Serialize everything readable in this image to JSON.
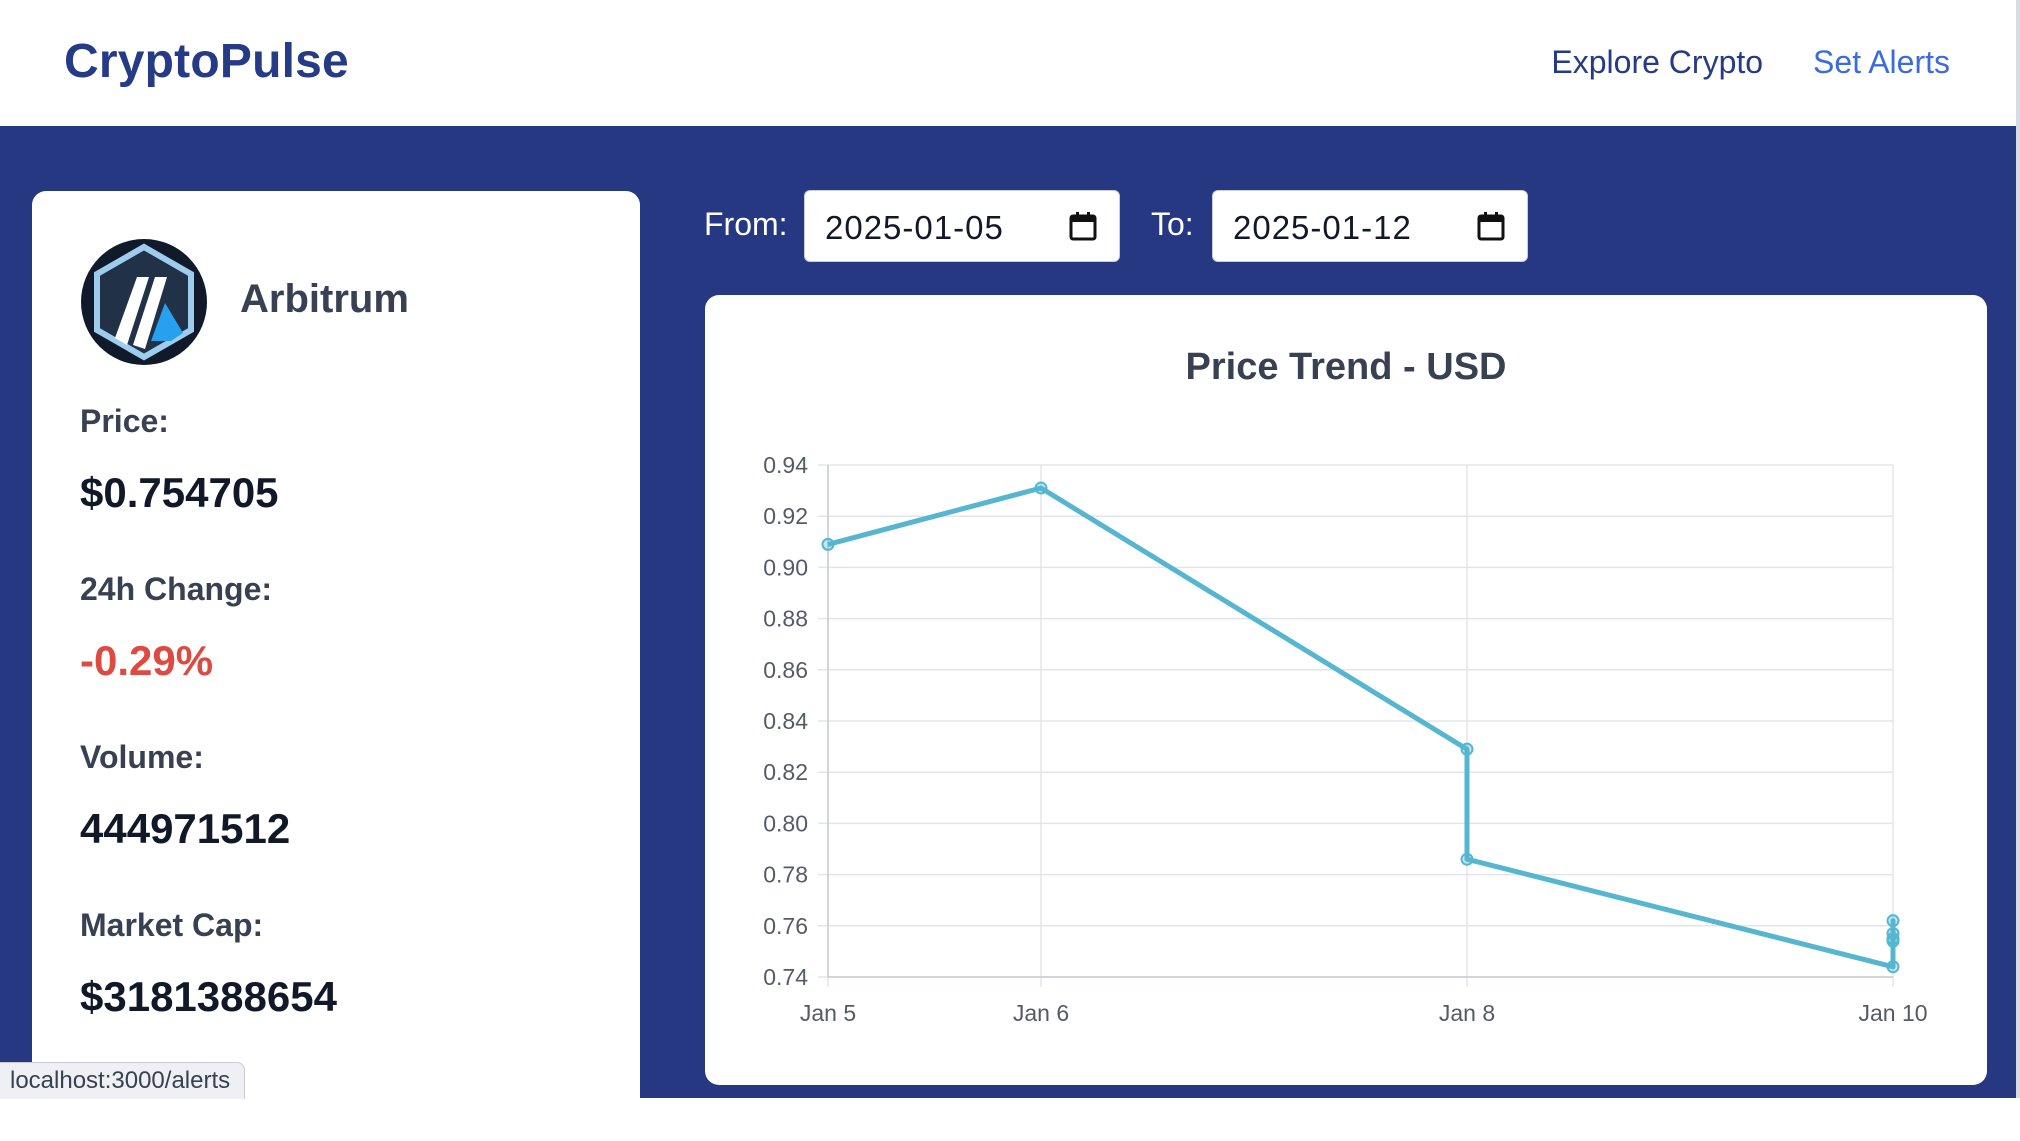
{
  "header": {
    "brand": "CryptoPulse",
    "nav": {
      "explore": "Explore Crypto",
      "alerts": "Set Alerts"
    }
  },
  "coin": {
    "name": "Arbitrum",
    "stats": [
      {
        "label": "Price:",
        "value": "$0.754705",
        "color": "#111827"
      },
      {
        "label": "24h Change:",
        "value": "-0.29%",
        "color": "#dc4a42"
      },
      {
        "label": "Volume:",
        "value": "444971512",
        "color": "#111827"
      },
      {
        "label": "Market Cap:",
        "value": "$3181388654",
        "color": "#111827"
      }
    ]
  },
  "date_range": {
    "from_label": "From:",
    "from_value": "2025-01-05",
    "to_label": "To:",
    "to_value": "2025-01-12"
  },
  "status_bar": {
    "url": "localhost:3000/alerts"
  },
  "colors": {
    "brand": "#253b86",
    "link": "#3c6be0",
    "background": "#263882",
    "line": "#56b6d0",
    "negative": "#dc4a42"
  },
  "chart_data": {
    "type": "line",
    "title": "Price Trend - USD",
    "x_ticks": [
      "Jan 5",
      "Jan 6",
      "Jan 8",
      "Jan 10"
    ],
    "y_ticks": [
      "0.94",
      "0.92",
      "0.90",
      "0.88",
      "0.86",
      "0.84",
      "0.82",
      "0.80",
      "0.78",
      "0.76",
      "0.74"
    ],
    "ylim": [
      0.74,
      0.94
    ],
    "xlim": [
      "2025-01-05",
      "2025-01-10"
    ],
    "grid": true,
    "series": [
      {
        "points": [
          {
            "x": "2025-01-05",
            "y": 0.909
          },
          {
            "x": "2025-01-06",
            "y": 0.931
          },
          {
            "x": "2025-01-08",
            "y": 0.829
          },
          {
            "x": "2025-01-08",
            "y": 0.786
          },
          {
            "x": "2025-01-10",
            "y": 0.744
          },
          {
            "x": "2025-01-10",
            "y": 0.762
          },
          {
            "x": "2025-01-10",
            "y": 0.755
          },
          {
            "x": "2025-01-10",
            "y": 0.757
          },
          {
            "x": "2025-01-10",
            "y": 0.754
          }
        ]
      }
    ]
  }
}
